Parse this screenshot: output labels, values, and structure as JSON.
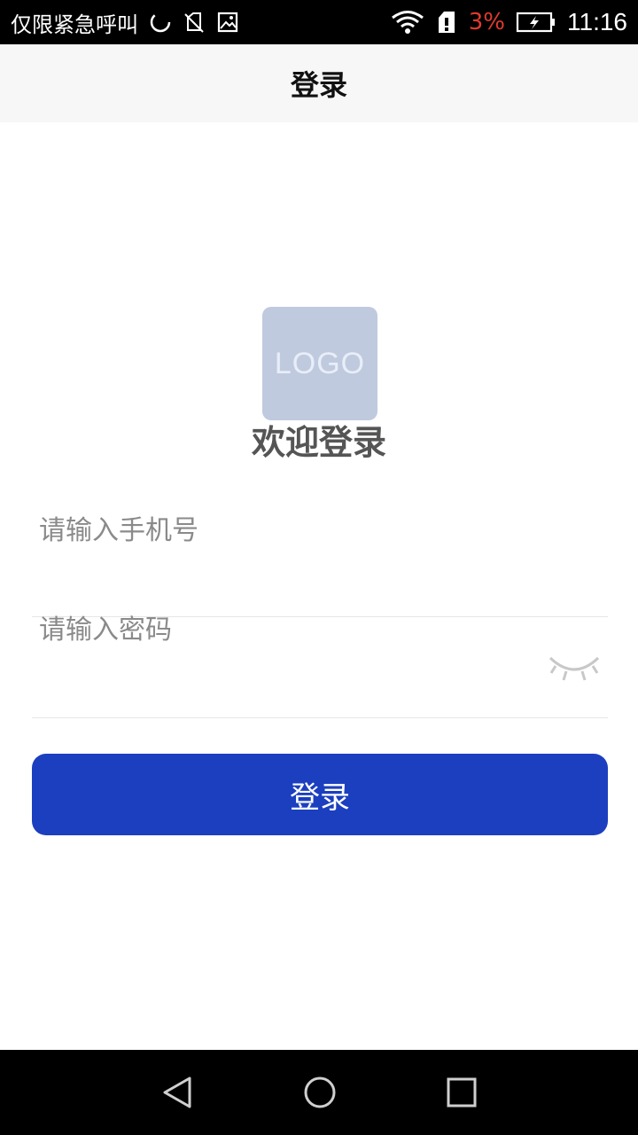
{
  "status_bar": {
    "carrier": "仅限紧急呼叫",
    "battery_percent": "3%",
    "battery_percent_color": "#e03a2f",
    "time": "11:16",
    "icons": [
      "loading-icon",
      "no-sim-icon",
      "image-icon",
      "wifi-icon",
      "sim-alert-icon",
      "battery-charging-icon"
    ]
  },
  "header": {
    "title": "登录"
  },
  "logo": {
    "text": "LOGO",
    "background": "#bfcadf"
  },
  "welcome": "欢迎登录",
  "form": {
    "phone_placeholder": "请输入手机号",
    "phone_value": "",
    "password_placeholder": "请输入密码",
    "password_value": "",
    "password_toggle_icon": "eye-closed-icon",
    "submit_label": "登录",
    "submit_color": "#1b3fbf"
  },
  "nav_bar": {
    "icons": [
      "back-icon",
      "home-icon",
      "recents-icon"
    ]
  }
}
